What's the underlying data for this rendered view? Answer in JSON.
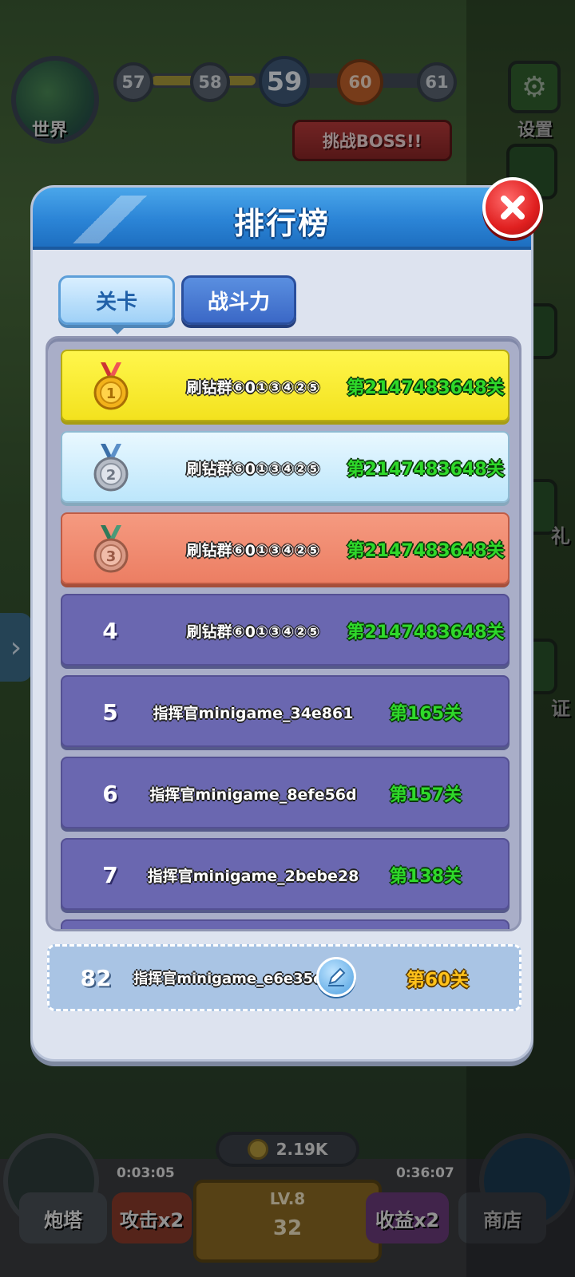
{
  "background": {
    "world_label": "世界",
    "level_track": [
      {
        "value": "57",
        "state": "past"
      },
      {
        "value": "58",
        "state": "past"
      },
      {
        "value": "59",
        "state": "current"
      },
      {
        "value": "60",
        "state": "next"
      },
      {
        "value": "61",
        "state": "future"
      }
    ],
    "settings_label": "设置",
    "boss_button": "挑战BOSS!!",
    "side_texts": {
      "gift": "礼",
      "verify": "证"
    },
    "coins": "2.19K",
    "left_timer": "0:03:05",
    "right_timer": "0:36:07",
    "turret_label": "炮塔",
    "attack_label": "攻击x2",
    "level_label": "LV.8",
    "level_cost": "32",
    "income_label": "收益x2",
    "shop_label": "商店"
  },
  "dialog": {
    "title": "排行榜",
    "tabs": [
      {
        "label": "关卡",
        "active": true
      },
      {
        "label": "战斗力",
        "active": false
      }
    ],
    "rankings": [
      {
        "rank": "1",
        "medal": "gold",
        "name": "刷钻群⑥0①③④②⑤",
        "level": "第2147483648关"
      },
      {
        "rank": "2",
        "medal": "silver",
        "name": "刷钻群⑥0①③④②⑤",
        "level": "第2147483648关"
      },
      {
        "rank": "3",
        "medal": "bronze",
        "name": "刷钻群⑥0①③④②⑤",
        "level": "第2147483648关"
      },
      {
        "rank": "4",
        "medal": "none",
        "name": "刷钻群⑥0①③④②⑤",
        "level": "第2147483648关"
      },
      {
        "rank": "5",
        "medal": "none",
        "name": "指挥官minigame_34e861",
        "level": "第165关"
      },
      {
        "rank": "6",
        "medal": "none",
        "name": "指挥官minigame_8efe56d",
        "level": "第157关"
      },
      {
        "rank": "7",
        "medal": "none",
        "name": "指挥官minigame_2bebe28",
        "level": "第138关"
      }
    ],
    "my_rank": {
      "rank": "82",
      "name": "指挥官minigame_e6e35c",
      "level": "第60关"
    }
  },
  "colors": {
    "header_blue": "#2b84d6",
    "gold_row": "#f3e21e",
    "silver_row": "#bce6fb",
    "bronze_row": "#ec7e63",
    "normal_row": "#6a67b0",
    "level_green": "#2fd92a",
    "my_level_yellow": "#ffc21a"
  }
}
